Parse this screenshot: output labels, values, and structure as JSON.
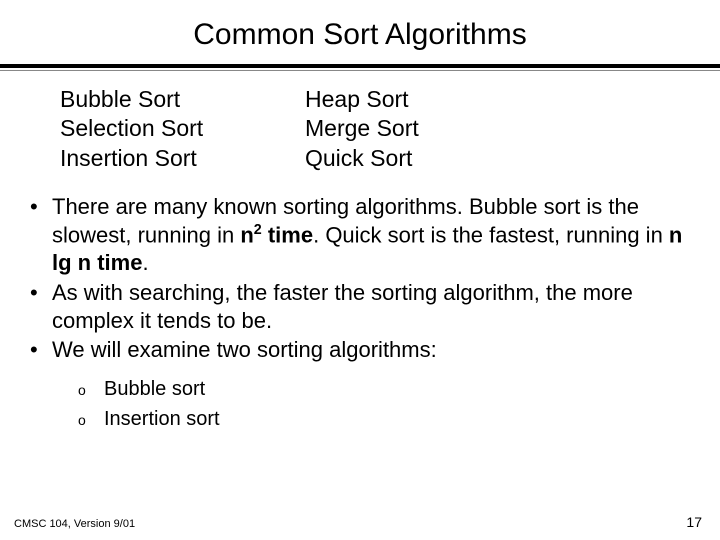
{
  "title": "Common Sort Algorithms",
  "left_col": {
    "r0": "Bubble Sort",
    "r1": "Selection Sort",
    "r2": "Insertion Sort"
  },
  "right_col": {
    "r0": "Heap Sort",
    "r1": "Merge Sort",
    "r2": "Quick Sort"
  },
  "bullet1": {
    "t1": "There are many known sorting algorithms.   Bubble sort is the slowest, running in  ",
    "n": "n",
    "sup": "2",
    "time1": " time",
    "t2": ".  Quick sort is the fastest, running in  ",
    "nlgn": "n lg n  time",
    "t3": "."
  },
  "bullet2": "As with searching, the faster the sorting algorithm, the more complex it tends to be.",
  "bullet3": "We will examine two sorting algorithms:",
  "sub": {
    "s0": "Bubble sort",
    "s1": "Insertion sort"
  },
  "footer_left": "CMSC 104, Version 9/01",
  "footer_right": "17",
  "marker": "•",
  "sub_marker": "o"
}
